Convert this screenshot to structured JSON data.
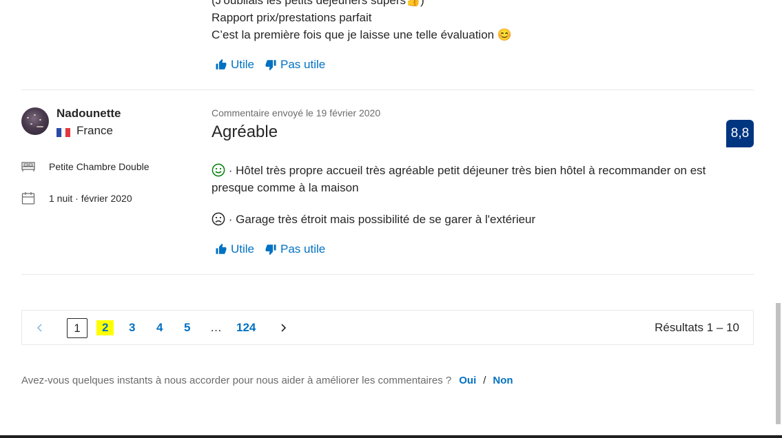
{
  "previous_review": {
    "lines": [
      "(J'oubliais les petits déjeuners supers👍)",
      "Rapport prix/prestations parfait",
      "C’est la première fois que je laisse une telle évaluation 😊"
    ],
    "helpful_label": "Utile",
    "not_helpful_label": "Pas utile"
  },
  "review": {
    "reviewer_name": "Nadounette",
    "country": "France",
    "room_type": "Petite Chambre Double",
    "stay": "1 nuit · février 2020",
    "date_text": "Commentaire envoyé le 19 février 2020",
    "title": "Agréable",
    "score": "8,8",
    "positive_text": "· Hôtel très propre accueil très agréable petit déjeuner très bien hôtel à recommander on est presque comme à la maison",
    "negative_text": "· Garage très étroit mais possibilité de se garer à l'extérieur",
    "helpful_label": "Utile",
    "not_helpful_label": "Pas utile"
  },
  "pagination": {
    "current_page": "1",
    "pages": [
      "2",
      "3",
      "4",
      "5"
    ],
    "ellipsis": "…",
    "last_page": "124",
    "results": "Résultats 1 – 10"
  },
  "survey": {
    "question": "Avez-vous quelques instants à nous accorder pour nous aider à améliorer les commentaires ?",
    "yes": "Oui",
    "separator": "/",
    "no": "Non"
  },
  "colors": {
    "link": "#0071c2",
    "score_bg": "#003580",
    "positive": "#008009",
    "highlight": "#ffff00"
  }
}
